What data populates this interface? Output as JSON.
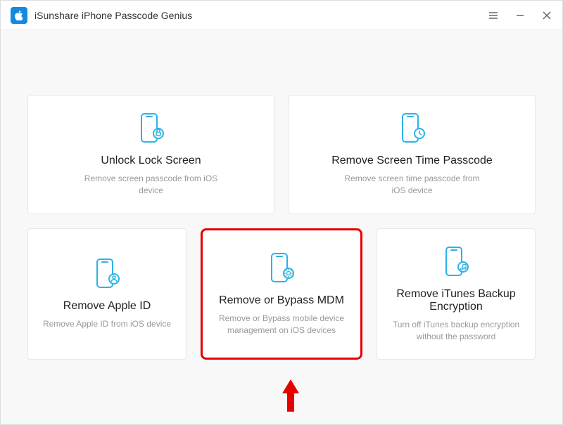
{
  "app": {
    "title": "iSunshare iPhone Passcode Genius"
  },
  "cards": {
    "unlock": {
      "title": "Unlock Lock Screen",
      "desc": "Remove screen passcode from iOS device"
    },
    "screentime": {
      "title": "Remove Screen Time Passcode",
      "desc": "Remove screen time passcode from iOS device"
    },
    "appleid": {
      "title": "Remove Apple ID",
      "desc": "Remove Apple ID from iOS device"
    },
    "mdm": {
      "title": "Remove or Bypass MDM",
      "desc": "Remove or Bypass mobile device management on iOS devices"
    },
    "itunes": {
      "title": "Remove iTunes Backup Encryption",
      "desc": "Turn off iTunes backup encryption without the password"
    }
  }
}
